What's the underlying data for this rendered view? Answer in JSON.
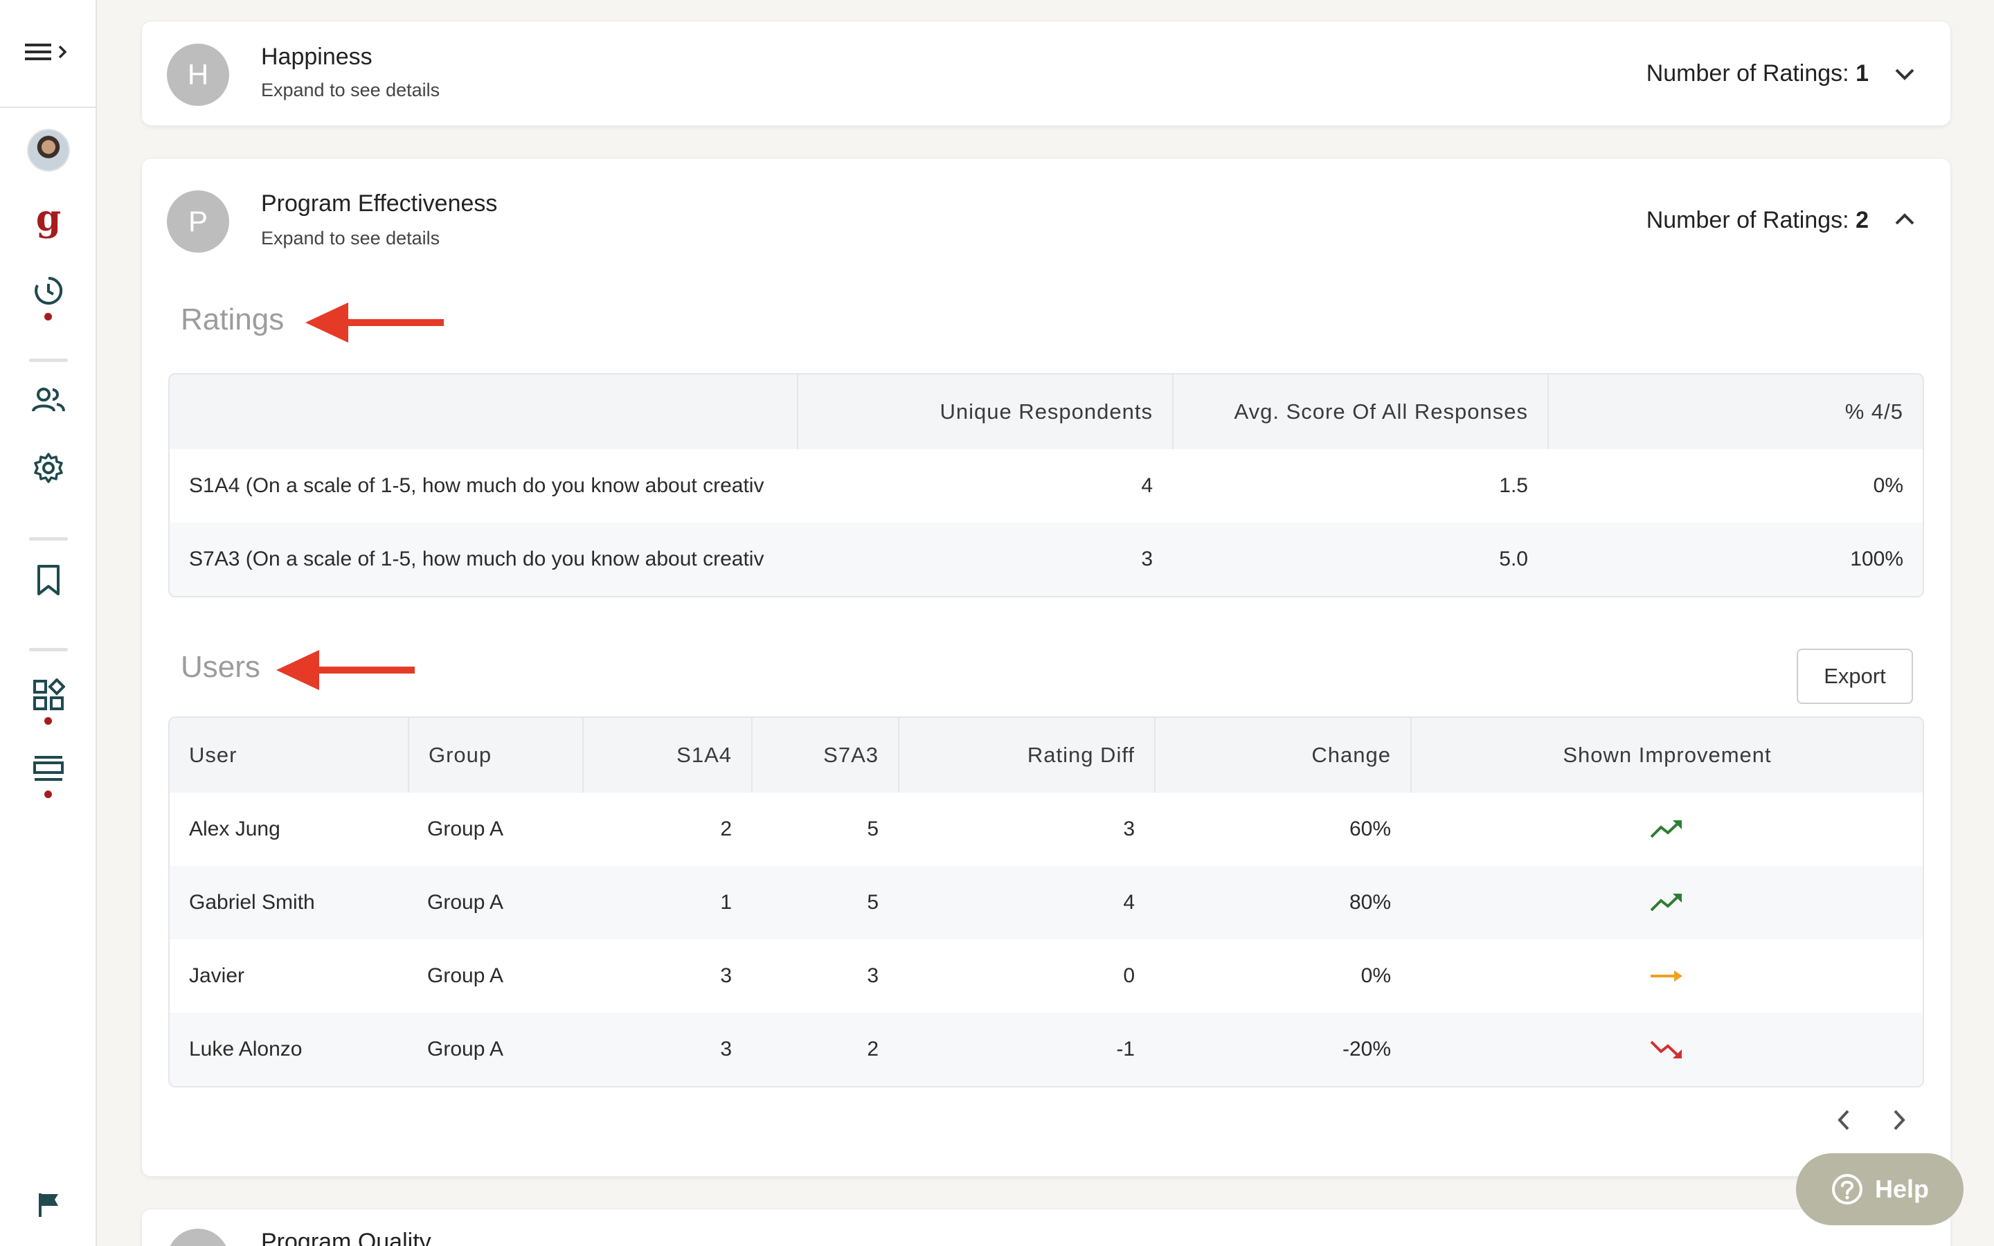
{
  "sidebar": {
    "menu_icon": "menu-expand-icon",
    "items": [
      "avatar",
      "g-logo-icon",
      "history-icon",
      "people-icon",
      "gear-icon",
      "bookmark-icon",
      "widgets-icon",
      "list-layout-icon",
      "flag-icon"
    ],
    "logo_letter": "g",
    "accent_color": "#a51c1c"
  },
  "cards": {
    "happiness": {
      "initial": "H",
      "title": "Happiness",
      "subtitle": "Expand to see details",
      "count_label": "Number of Ratings:",
      "count_value": "1"
    },
    "program_effectiveness": {
      "initial": "P",
      "title": "Program Effectiveness",
      "subtitle": "Expand to see details",
      "count_label": "Number of Ratings:",
      "count_value": "2",
      "ratings_label": "Ratings",
      "ratings_table": {
        "headers": [
          "",
          "Unique Respondents",
          "Avg. Score Of All Responses",
          "% 4/5"
        ],
        "rows": [
          [
            "S1A4 (On a scale of 1-5, how much do you know about creativ",
            "4",
            "1.5",
            "0%"
          ],
          [
            "S7A3 (On a scale of 1-5, how much do you know about creativ",
            "3",
            "5.0",
            "100%"
          ]
        ]
      },
      "users_label": "Users",
      "export_label": "Export",
      "users_table": {
        "headers": [
          "User",
          "Group",
          "S1A4",
          "S7A3",
          "Rating Diff",
          "Change",
          "Shown Improvement"
        ],
        "rows": [
          [
            "Alex Jung",
            "Group A",
            "2",
            "5",
            "3",
            "60%",
            "trending-up-icon"
          ],
          [
            "Gabriel Smith",
            "Group A",
            "1",
            "5",
            "4",
            "80%",
            "trending-up-icon"
          ],
          [
            "Javier",
            "Group A",
            "3",
            "3",
            "0",
            "0%",
            "arrow-right-icon"
          ],
          [
            "Luke Alonzo",
            "Group A",
            "3",
            "2",
            "-1",
            "-20%",
            "trending-down-icon"
          ]
        ]
      }
    },
    "program_quality": {
      "title": "Program Quality"
    }
  },
  "help": {
    "label": "Help"
  },
  "colors": {
    "up": "#2e7d32",
    "flat": "#f0a020",
    "down": "#d32f2f",
    "annotation_arrow": "#e53a26"
  }
}
